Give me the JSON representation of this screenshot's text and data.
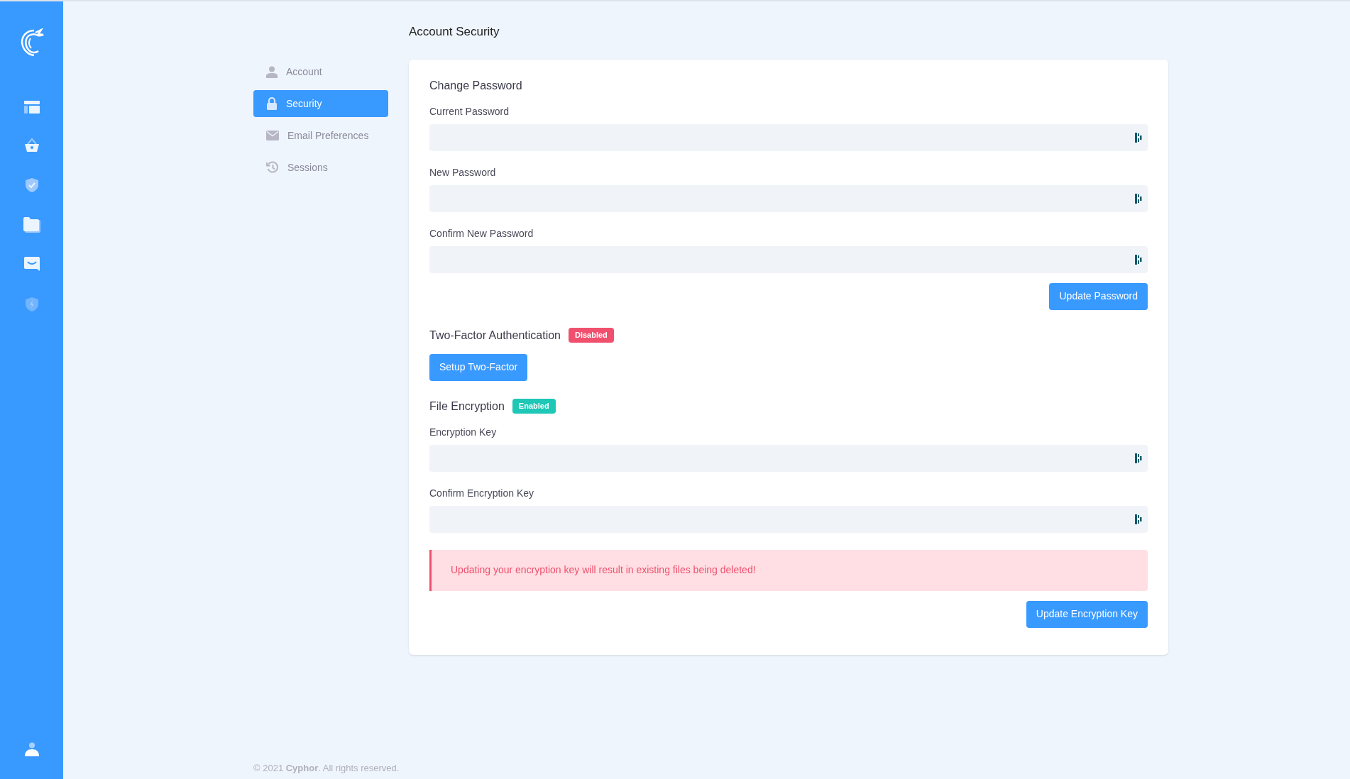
{
  "rail": {
    "items": [
      {
        "kind": "layout",
        "selected": false
      },
      {
        "kind": "basket",
        "selected": false
      },
      {
        "kind": "shield-check",
        "selected": false
      },
      {
        "kind": "folder",
        "selected": false
      },
      {
        "kind": "chat",
        "selected": false
      },
      {
        "kind": "shield-bolt",
        "selected": false
      }
    ]
  },
  "page_title": "Account Security",
  "nav": [
    {
      "label": "Account",
      "kind": "user",
      "selected": false
    },
    {
      "label": "Security",
      "kind": "lock",
      "selected": true
    },
    {
      "label": "Email Preferences",
      "kind": "mail",
      "selected": false
    },
    {
      "label": "Sessions",
      "kind": "history",
      "selected": false
    }
  ],
  "sections": [
    {
      "title": "Change Password",
      "fields": [
        {
          "label": "Current Password"
        },
        {
          "label": "New Password"
        },
        {
          "label": "Confirm New Password"
        }
      ],
      "button": "Update Password"
    },
    {
      "title": "Two-Factor Authentication",
      "badge": {
        "text": "Disabled",
        "color": "#f0506e"
      },
      "button_left": "Setup Two-Factor"
    },
    {
      "title": "File Encryption",
      "badge": {
        "text": "Enabled",
        "color": "#1fc7b6"
      },
      "fields": [
        {
          "label": "Encryption Key"
        },
        {
          "label": "Confirm Encryption Key"
        }
      ],
      "alert": "Updating your encryption key will result in existing files being deleted!",
      "button": "Update Encryption Key"
    }
  ],
  "footer": {
    "text": "© 2021 **Cyphor**. All rights reserved."
  }
}
